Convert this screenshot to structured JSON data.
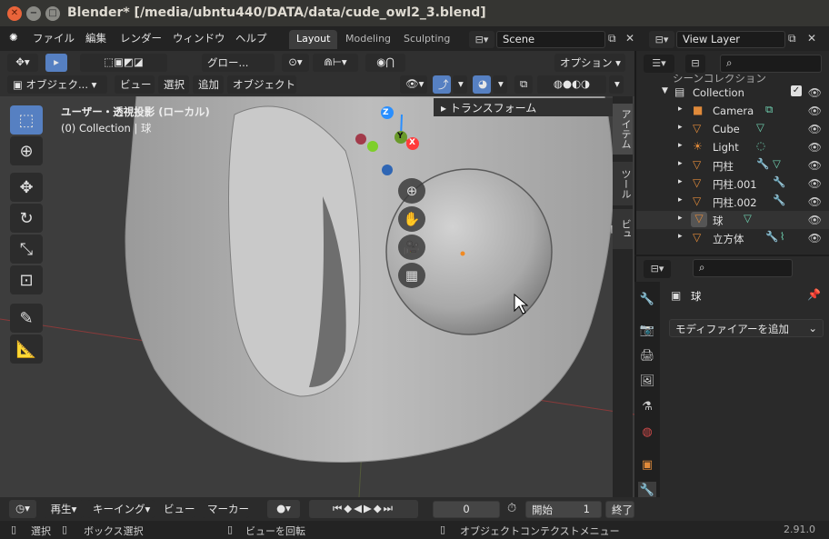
{
  "window": {
    "title": "Blender* [/media/ubntu440/DATA/data/cude_owl2_3.blend]",
    "close_icon": "close-icon",
    "minimize_icon": "minimize-icon",
    "maximize_icon": "maximize-icon"
  },
  "menu": {
    "items": [
      "ファイル",
      "編集",
      "レンダー",
      "ウィンドウ",
      "ヘルプ"
    ]
  },
  "workspace_tabs": [
    "Layout",
    "Modeling",
    "Sculpting"
  ],
  "scene": {
    "name": "Scene"
  },
  "view_layer": {
    "name": "View Layer"
  },
  "viewport_header": {
    "transform_orientation": "グロー...",
    "options_label": "オプション",
    "mode": "オブジェク...",
    "menus": [
      "ビュー",
      "選択",
      "追加",
      "オブジェクト"
    ]
  },
  "viewport": {
    "info_line1": "ユーザー・透視投影 (ローカル)",
    "info_line2": "(0) Collection | 球",
    "transform_panel": "トランスフォーム",
    "gizmo": {
      "z": "Z",
      "y": "Y",
      "x": "X"
    },
    "n_tabs": [
      "アイテム",
      "ツール",
      "ビュー"
    ]
  },
  "outliner": {
    "top_label": "シーンコレクション",
    "collection": "Collection",
    "items": [
      {
        "name": "Camera",
        "icon": "camera-icon"
      },
      {
        "name": "Cube",
        "icon": "mesh-icon"
      },
      {
        "name": "Light",
        "icon": "light-icon"
      },
      {
        "name": "円柱",
        "icon": "mesh-icon"
      },
      {
        "name": "円柱.001",
        "icon": "mesh-icon"
      },
      {
        "name": "円柱.002",
        "icon": "mesh-icon"
      },
      {
        "name": "球",
        "icon": "mesh-icon"
      },
      {
        "name": "立方体",
        "icon": "mesh-icon"
      }
    ]
  },
  "properties": {
    "object_name": "球",
    "add_modifier": "モディファイアーを追加"
  },
  "timeline": {
    "playback": "再生",
    "keying": "キーイング",
    "view": "ビュー",
    "marker": "マーカー",
    "current_frame": "0",
    "start_label": "開始",
    "start_value": "1",
    "end_label": "終了"
  },
  "statusbar": {
    "select": "選択",
    "box_select": "ボックス選択",
    "rotate_view": "ビューを回転",
    "context_menu": "オブジェクトコンテクストメニュー",
    "version": "2.91.0"
  }
}
